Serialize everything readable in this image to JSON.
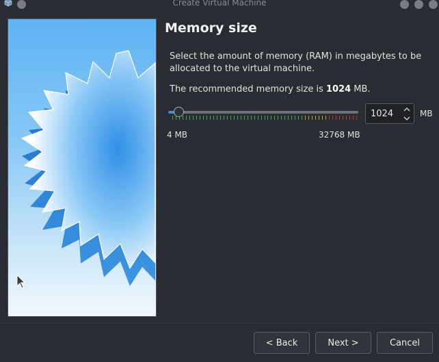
{
  "window": {
    "title": "Create Virtual Machine"
  },
  "page": {
    "heading": "Memory size",
    "description": "Select the amount of memory (RAM) in megabytes to be allocated to the virtual machine.",
    "recommend_prefix": "The recommended memory size is ",
    "recommend_value": "1024",
    "recommend_suffix": " MB."
  },
  "memory": {
    "slider_min_label": "4 MB",
    "slider_max_label": "32768 MB",
    "min_mb": 4,
    "max_mb": 32768,
    "value_mb": 1024,
    "spinbox_value": "1024",
    "unit": "MB"
  },
  "buttons": {
    "back": "< Back",
    "next": "Next >",
    "cancel": "Cancel"
  },
  "icons": {
    "app": "virtualbox-cube-icon",
    "spin_up": "chevron-up-icon",
    "spin_down": "chevron-down-icon",
    "pointer": "mouse-pointer-icon"
  },
  "colors": {
    "background": "#2a2c33",
    "accent": "#3d8fd6",
    "tick_ok": "#3fae4a",
    "tick_warn": "#c9a227",
    "tick_bad": "#c0392b"
  }
}
